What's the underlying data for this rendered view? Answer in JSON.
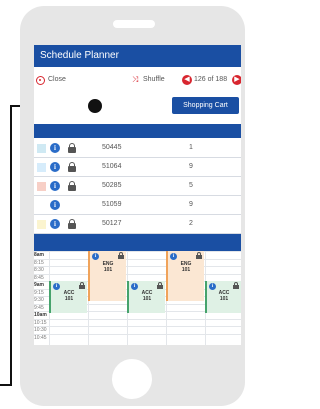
{
  "app": {
    "title": "Schedule Planner"
  },
  "toolbar": {
    "close_label": "Close",
    "shuffle_label": "Shuffle",
    "pager_text": "126 of 188"
  },
  "shopping_cart_label": "Shopping Cart",
  "courses": [
    {
      "id": "50445",
      "count": "1",
      "color": "#cfe9f3",
      "info": "i",
      "locked": true
    },
    {
      "id": "51064",
      "count": "9",
      "color": "#d6ecfb",
      "info": "i",
      "locked": true
    },
    {
      "id": "50285",
      "count": "5",
      "color": "#f7cfc6",
      "info": "i",
      "locked": true
    },
    {
      "id": "51059",
      "count": "9",
      "color": "",
      "info": "i",
      "locked": false
    },
    {
      "id": "50127",
      "count": "2",
      "color": "#fbf4cf",
      "info": "i",
      "locked": true
    }
  ],
  "calendar": {
    "times": [
      {
        "label": "8am",
        "major": true
      },
      {
        "label": "8:15",
        "major": false
      },
      {
        "label": "8:30",
        "major": false
      },
      {
        "label": "8:45",
        "major": false
      },
      {
        "label": "9am",
        "major": true
      },
      {
        "label": "9:15",
        "major": false
      },
      {
        "label": "9:30",
        "major": false
      },
      {
        "label": "9:45",
        "major": false
      },
      {
        "label": "10am",
        "major": true
      },
      {
        "label": "10:15",
        "major": false
      },
      {
        "label": "10:30",
        "major": false
      },
      {
        "label": "10:45",
        "major": false
      }
    ],
    "events": [
      {
        "line1": "ENG",
        "line2": "101",
        "kind": "eng"
      },
      {
        "line1": "ENG",
        "line2": "101",
        "kind": "eng"
      },
      {
        "line1": "ACC",
        "line2": "101",
        "kind": "acc"
      },
      {
        "line1": "ACC",
        "line2": "101",
        "kind": "acc"
      },
      {
        "line1": "ACC",
        "line2": "101",
        "kind": "acc"
      }
    ]
  },
  "colors": {
    "brand_blue": "#1a4fa3",
    "accent_red": "#d8262f",
    "eng_fill": "#fbe7d3",
    "acc_fill": "#dff1e5"
  },
  "icons": {
    "close": "close-circle-icon",
    "shuffle": "shuffle-icon",
    "prev": "arrow-left-circle-icon",
    "next": "arrow-right-circle-icon",
    "info": "info-icon",
    "lock": "lock-icon"
  }
}
